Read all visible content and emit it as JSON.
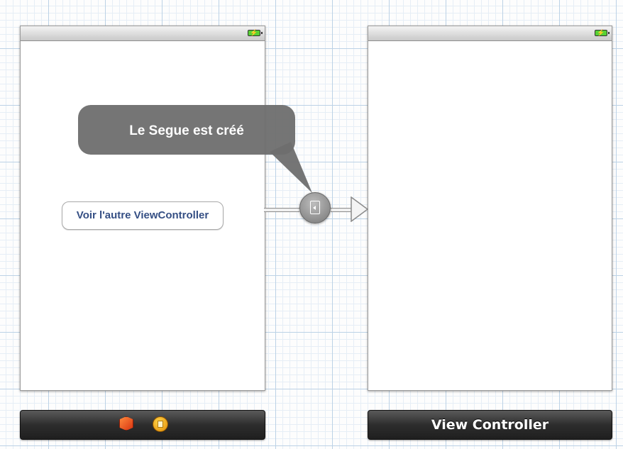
{
  "canvas": {
    "scenes": [
      {
        "name": "first-scene",
        "button_label": "Voir l'autre ViewController",
        "dock_icons": [
          "first-responder-cube-icon",
          "view-controller-icon"
        ]
      },
      {
        "name": "second-scene",
        "dock_title": "View Controller"
      }
    ],
    "callout": {
      "text": "Le Segue est créé"
    },
    "segue": {
      "icon": "segue-modal-icon"
    },
    "status_bar": {
      "battery_icon": "battery-charging-icon",
      "battery_color": "#58d035"
    }
  }
}
